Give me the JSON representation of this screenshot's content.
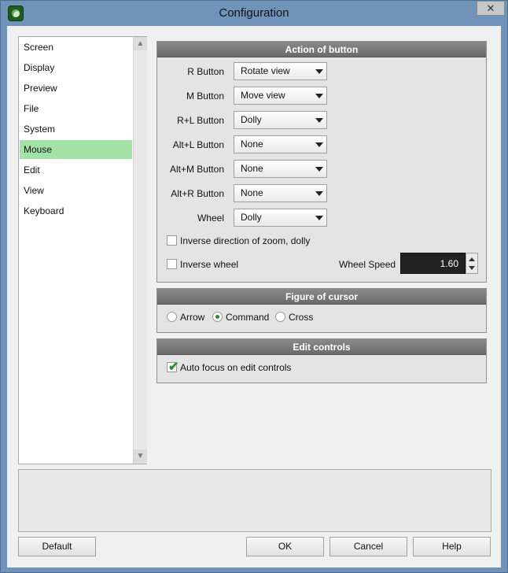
{
  "window": {
    "title": "Configuration",
    "close_glyph": "✕"
  },
  "sidebar": {
    "items": [
      {
        "label": "Screen"
      },
      {
        "label": "Display"
      },
      {
        "label": "Preview"
      },
      {
        "label": "File"
      },
      {
        "label": "System"
      },
      {
        "label": "Mouse",
        "selected": true
      },
      {
        "label": "Edit"
      },
      {
        "label": "View"
      },
      {
        "label": "Keyboard"
      }
    ]
  },
  "action_of_button": {
    "header": "Action of button",
    "rows": [
      {
        "label": "R Button",
        "value": "Rotate view"
      },
      {
        "label": "M Button",
        "value": "Move view"
      },
      {
        "label": "R+L Button",
        "value": "Dolly"
      },
      {
        "label": "Alt+L Button",
        "value": "None"
      },
      {
        "label": "Alt+M Button",
        "value": "None"
      },
      {
        "label": "Alt+R Button",
        "value": "None"
      },
      {
        "label": "Wheel",
        "value": "Dolly"
      }
    ],
    "inverse_zoom_label": "Inverse direction of zoom, dolly",
    "inverse_zoom_checked": false,
    "inverse_wheel_label": "Inverse wheel",
    "inverse_wheel_checked": false,
    "wheel_speed_label": "Wheel Speed",
    "wheel_speed_value": "1.60"
  },
  "figure_of_cursor": {
    "header": "Figure of cursor",
    "options": [
      {
        "label": "Arrow",
        "checked": false
      },
      {
        "label": "Command",
        "checked": true
      },
      {
        "label": "Cross",
        "checked": false
      }
    ]
  },
  "edit_controls": {
    "header": "Edit controls",
    "auto_focus_label": "Auto focus on edit controls",
    "auto_focus_checked": true
  },
  "buttons": {
    "default_label": "Default",
    "ok_label": "OK",
    "cancel_label": "Cancel",
    "help_label": "Help"
  },
  "colors": {
    "selected_item": "#a2e2a7",
    "group_header": "#7a7a7a",
    "check_accent": "#2f8f2f"
  }
}
